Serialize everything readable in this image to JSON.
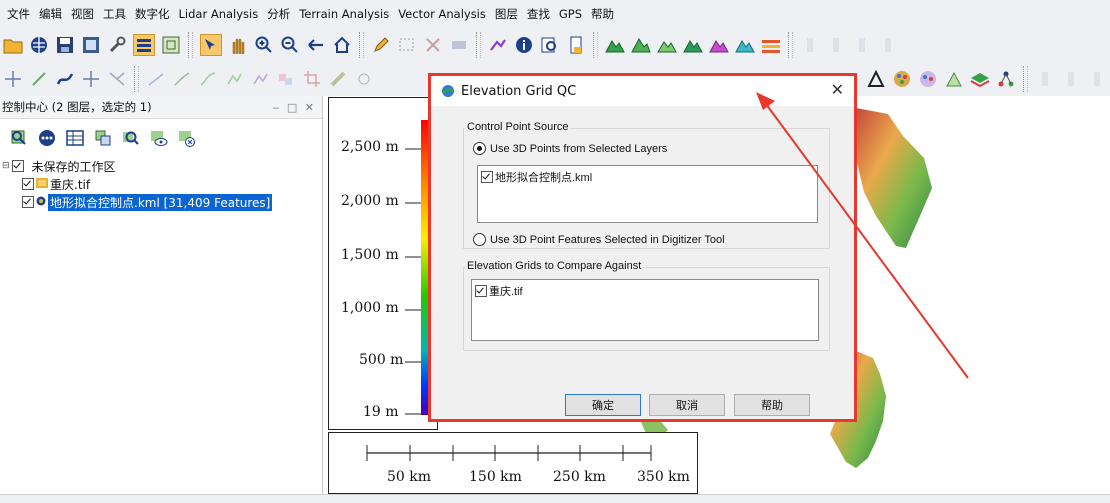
{
  "menu": [
    "文件",
    "编辑",
    "视图",
    "工具",
    "数字化",
    "Lidar Analysis",
    "分析",
    "Terrain Analysis",
    "Vector Analysis",
    "图层",
    "查找",
    "GPS",
    "帮助"
  ],
  "panel": {
    "title": "控制中心 (2 图层，选定的 1)",
    "workspace": "未保存的工作区",
    "layers": [
      "重庆.tif",
      "地形拟合控制点.kml [31,409 Features]"
    ]
  },
  "legend": {
    "labels": [
      "2,500 m",
      "2,000 m",
      "1,500 m",
      "1,000 m",
      "500 m",
      "19 m"
    ]
  },
  "scalebar": {
    "labels": [
      "50 km",
      "150 km",
      "250 km",
      "350 km"
    ]
  },
  "dialog": {
    "title": "Elevation Grid QC",
    "group1_title": "Control Point Source",
    "radio1": "Use 3D Points from Selected Layers",
    "radio2": "Use 3D Point Features Selected in Digitizer Tool",
    "list1": [
      "地形拟合控制点.kml"
    ],
    "group2_title": "Elevation Grids to Compare Against",
    "list2": [
      "重庆.tif"
    ],
    "ok": "确定",
    "cancel": "取消",
    "help": "帮助"
  },
  "colors": {
    "highlight": "#e8372c",
    "selection": "#0a64d1"
  }
}
